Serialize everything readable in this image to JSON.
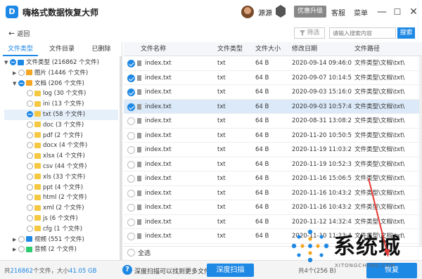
{
  "app": {
    "logo_letter": "D",
    "title": "嗨格式数据恢复大师"
  },
  "header": {
    "user_name": "源源",
    "upgrade_label": "优惠升级",
    "service_label": "客服",
    "menu_label": "菜单",
    "minimize_glyph": "—",
    "maximize_glyph": "☐",
    "close_glyph": "✕"
  },
  "toolbar": {
    "back_arrow": "←",
    "back_label": "返回",
    "filter_label": "筛选",
    "filter_icon": "funnel-icon",
    "search_placeholder": "请输入搜索内容",
    "search_label": "搜索"
  },
  "left_tabs": [
    "文件类型",
    "文件目录",
    "已删除"
  ],
  "tree": [
    {
      "indent": 0,
      "twisty": "▼",
      "check": "partial",
      "icon": "drive",
      "color": "#1e88e5",
      "label": "文件类型 (216862 个文件)",
      "selected": false
    },
    {
      "indent": 1,
      "twisty": "▶",
      "check": "off",
      "icon": "image",
      "color": "#f5a623",
      "label": "图片 (1446 个文件)",
      "selected": false
    },
    {
      "indent": 1,
      "twisty": "▼",
      "check": "partial",
      "icon": "doc",
      "color": "#f5a623",
      "label": "文档 (206 个文件)",
      "selected": false
    },
    {
      "indent": 2,
      "twisty": "",
      "check": "off",
      "icon": "folder",
      "color": "#f5c842",
      "label": "log (30 个文件)",
      "selected": false
    },
    {
      "indent": 2,
      "twisty": "",
      "check": "off",
      "icon": "folder",
      "color": "#f5c842",
      "label": "ini (13 个文件)",
      "selected": false
    },
    {
      "indent": 2,
      "twisty": "",
      "check": "partial",
      "icon": "folder",
      "color": "#f5c842",
      "label": "txt (58 个文件)",
      "selected": true
    },
    {
      "indent": 2,
      "twisty": "",
      "check": "off",
      "icon": "folder",
      "color": "#f5c842",
      "label": "doc (3 个文件)",
      "selected": false
    },
    {
      "indent": 2,
      "twisty": "",
      "check": "off",
      "icon": "folder",
      "color": "#f5c842",
      "label": "pdf (2 个文件)",
      "selected": false
    },
    {
      "indent": 2,
      "twisty": "",
      "check": "off",
      "icon": "folder",
      "color": "#f5c842",
      "label": "docx (4 个文件)",
      "selected": false
    },
    {
      "indent": 2,
      "twisty": "",
      "check": "off",
      "icon": "folder",
      "color": "#f5c842",
      "label": "xlsx (4 个文件)",
      "selected": false
    },
    {
      "indent": 2,
      "twisty": "",
      "check": "off",
      "icon": "folder",
      "color": "#f5c842",
      "label": "csv (44 个文件)",
      "selected": false
    },
    {
      "indent": 2,
      "twisty": "",
      "check": "off",
      "icon": "folder",
      "color": "#f5c842",
      "label": "xls (33 个文件)",
      "selected": false
    },
    {
      "indent": 2,
      "twisty": "",
      "check": "off",
      "icon": "folder",
      "color": "#f5c842",
      "label": "ppt (4 个文件)",
      "selected": false
    },
    {
      "indent": 2,
      "twisty": "",
      "check": "off",
      "icon": "folder",
      "color": "#f5c842",
      "label": "html (2 个文件)",
      "selected": false
    },
    {
      "indent": 2,
      "twisty": "",
      "check": "off",
      "icon": "folder",
      "color": "#f5c842",
      "label": "xml (2 个文件)",
      "selected": false
    },
    {
      "indent": 2,
      "twisty": "",
      "check": "off",
      "icon": "folder",
      "color": "#f5c842",
      "label": "js (6 个文件)",
      "selected": false
    },
    {
      "indent": 2,
      "twisty": "",
      "check": "off",
      "icon": "folder",
      "color": "#f5c842",
      "label": "cfg (1 个文件)",
      "selected": false
    },
    {
      "indent": 1,
      "twisty": "▶",
      "check": "off",
      "icon": "video",
      "color": "#1e88e5",
      "label": "视频 (551 个文件)",
      "selected": false
    },
    {
      "indent": 1,
      "twisty": "▶",
      "check": "off",
      "icon": "audio",
      "color": "#2ecc71",
      "label": "音频 (2 个文件)",
      "selected": false
    }
  ],
  "table": {
    "columns": [
      "文件名称",
      "文件类型",
      "文件大小",
      "修改日期",
      "文件路径"
    ],
    "rows": [
      {
        "checked": true,
        "selected": false,
        "name": "index.txt",
        "type": "txt",
        "size": "64 B",
        "date": "2020-09-14 09:46:07",
        "path": "文件类型\\文档\\txt\\"
      },
      {
        "checked": true,
        "selected": false,
        "name": "index.txt",
        "type": "txt",
        "size": "64 B",
        "date": "2020-09-07 10:14:52",
        "path": "文件类型\\文档\\txt\\"
      },
      {
        "checked": true,
        "selected": false,
        "name": "index.txt",
        "type": "txt",
        "size": "64 B",
        "date": "2020-09-03 15:16:09",
        "path": "文件类型\\文档\\txt\\"
      },
      {
        "checked": true,
        "selected": true,
        "name": "index.txt",
        "type": "txt",
        "size": "64 B",
        "date": "2020-09-03 10:57:40",
        "path": "文件类型\\文档\\txt\\"
      },
      {
        "checked": false,
        "selected": false,
        "name": "index.txt",
        "type": "txt",
        "size": "64 B",
        "date": "2020-08-31 13:08:20",
        "path": "文件类型\\文档\\txt\\"
      },
      {
        "checked": false,
        "selected": false,
        "name": "index.txt",
        "type": "txt",
        "size": "64 B",
        "date": "2020-11-20 10:50:53",
        "path": "文件类型\\文档\\txt\\"
      },
      {
        "checked": false,
        "selected": false,
        "name": "index.txt",
        "type": "txt",
        "size": "64 B",
        "date": "2020-11-19 11:03:20",
        "path": "文件类型\\文档\\txt\\"
      },
      {
        "checked": false,
        "selected": false,
        "name": "index.txt",
        "type": "txt",
        "size": "64 B",
        "date": "2020-11-19 10:52:39",
        "path": "文件类型\\文档\\txt\\"
      },
      {
        "checked": false,
        "selected": false,
        "name": "index.txt",
        "type": "txt",
        "size": "64 B",
        "date": "2020-11-16 15:06:57",
        "path": "文件类型\\文档\\txt\\"
      },
      {
        "checked": false,
        "selected": false,
        "name": "index.txt",
        "type": "txt",
        "size": "64 B",
        "date": "2020-11-16 10:43:27",
        "path": "文件类型\\文档\\txt\\"
      },
      {
        "checked": false,
        "selected": false,
        "name": "index.txt",
        "type": "txt",
        "size": "64 B",
        "date": "2020-11-16 10:43:25",
        "path": "文件类型\\文档\\txt\\"
      },
      {
        "checked": false,
        "selected": false,
        "name": "index.txt",
        "type": "txt",
        "size": "64 B",
        "date": "2020-11-12 14:32:47",
        "path": "文件类型\\文档\\txt\\"
      },
      {
        "checked": false,
        "selected": false,
        "name": "index.txt",
        "type": "txt",
        "size": "64 B",
        "date": "2020-11-10 11:23:48",
        "path": "文件类型\\文档\\txt\\"
      }
    ]
  },
  "footer": {
    "select_all_label": "全选",
    "total_prefix": "共",
    "total_count": "216862",
    "total_mid": "个文件，大小",
    "total_size": "41.05 GB",
    "help_glyph": "?",
    "deep_scan_hint": "深度扫描可以找到更多文件",
    "deep_scan_label": "深度扫描",
    "selected_summary": "共4个(256 B)",
    "recover_label": "恢复"
  },
  "watermark": {
    "text": "系统城",
    "subtext": "XITONGCHENG.COM"
  },
  "colors": {
    "accent": "#1e88e5",
    "selected_row": "#dbe9f8",
    "header_bg": "#f4f6f9"
  }
}
